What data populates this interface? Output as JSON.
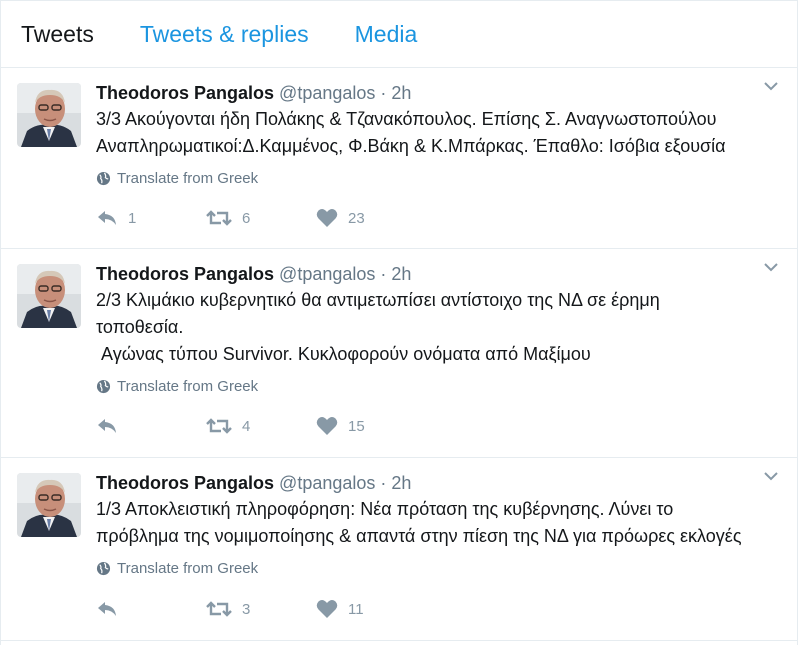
{
  "tabs": {
    "tweets": "Tweets",
    "replies": "Tweets & replies",
    "media": "Media"
  },
  "tweets": [
    {
      "name": "Theodoros Pangalos",
      "handle": "@tpangalos",
      "sep": "·",
      "time": "2h",
      "lines": [
        "3/3 Ακούγονται ήδη Πολάκης & Τζανακόπουλος. Επίσης Σ. Αναγνωστοπούλου",
        "Αναπληρωματικοί:Δ.Καμμένος, Φ.Βάκη & Κ.Μπάρκας. Έπαθλο: Ισόβια εξουσία"
      ],
      "translate": "Translate from Greek",
      "replies": "1",
      "retweets": "6",
      "likes": "23"
    },
    {
      "name": "Theodoros Pangalos",
      "handle": "@tpangalos",
      "sep": "·",
      "time": "2h",
      "lines": [
        "2/3 Κλιμάκιο κυβερνητικό θα αντιμετωπίσει αντίστοιχο της ΝΔ σε έρημη",
        "τοποθεσία.",
        " Αγώνας τύπου Survivor. Κυκλοφορούν ονόματα από Μαξίμου"
      ],
      "translate": "Translate from Greek",
      "replies": "",
      "retweets": "4",
      "likes": "15"
    },
    {
      "name": "Theodoros Pangalos",
      "handle": "@tpangalos",
      "sep": "·",
      "time": "2h",
      "lines": [
        "1/3 Αποκλειστική πληροφόρηση: Νέα πρόταση της κυβέρνησης. Λύνει το",
        "πρόβλημα της νομιμοποίησης & απαντά στην πίεση της ΝΔ για πρόωρες εκλογές"
      ],
      "translate": "Translate from Greek",
      "replies": "",
      "retweets": "3",
      "likes": "11"
    }
  ],
  "colors": {
    "link": "#1b95e0",
    "muted": "#657786",
    "icon": "#8899a6",
    "border": "#e6ecf0"
  },
  "icons": [
    "avatar",
    "chevron-down-icon",
    "globe-icon",
    "reply-icon",
    "retweet-icon",
    "heart-icon"
  ]
}
